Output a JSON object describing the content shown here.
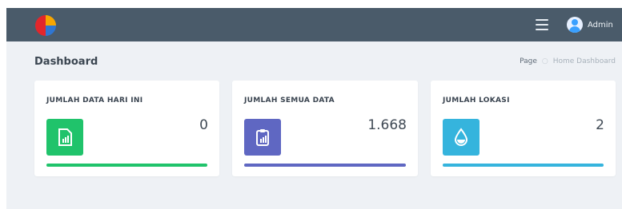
{
  "header": {
    "user_label": "Admin"
  },
  "page": {
    "title": "Dashboard",
    "breadcrumb": {
      "page": "Page",
      "home": "Home Dashboard"
    }
  },
  "cards": [
    {
      "label": "JUMLAH DATA HARI INI",
      "value": "0",
      "icon": "file-chart-icon",
      "color": "#20c36b"
    },
    {
      "label": "JUMLAH SEMUA DATA",
      "value": "1.668",
      "icon": "clipboard-chart-icon",
      "color": "#5f67c2"
    },
    {
      "label": "JUMLAH LOKASI",
      "value": "2",
      "icon": "water-drop-icon",
      "color": "#35b4dd"
    }
  ],
  "colors": {
    "topbar": "#4a5b6a",
    "background": "#eef1f5"
  }
}
